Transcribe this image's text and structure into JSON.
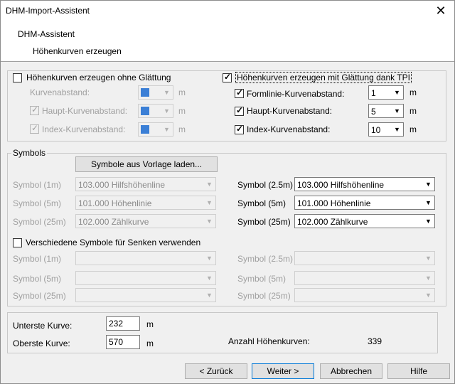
{
  "window": {
    "title": "DHM-Import-Assistent",
    "close_glyph": "✕"
  },
  "header": {
    "title": "DHM-Assistent",
    "subtitle": "Höhenkurven erzeugen"
  },
  "smoothing": {
    "without": {
      "label": "Höhenkurven erzeugen ohne Glättung",
      "checked": false
    },
    "with": {
      "label": "Höhenkurven erzeugen mit Glättung dank TPI",
      "checked": true
    }
  },
  "left_params": {
    "kurvenabstand": {
      "label": "Kurvenabstand:",
      "unit": "m"
    },
    "haupt": {
      "label": "Haupt-Kurvenabstand:",
      "unit": "m",
      "checked": true
    },
    "index": {
      "label": "Index-Kurvenabstand:",
      "unit": "m",
      "checked": true
    }
  },
  "right_params": {
    "formlinie": {
      "label": "Formlinie-Kurvenabstand:",
      "value": "1",
      "unit": "m",
      "checked": true
    },
    "haupt": {
      "label": "Haupt-Kurvenabstand:",
      "value": "5",
      "unit": "m",
      "checked": true
    },
    "index": {
      "label": "Index-Kurvenabstand:",
      "value": "10",
      "unit": "m",
      "checked": true
    }
  },
  "symbols": {
    "group_title": "Symbols",
    "load_button": "Symbole aus Vorlage laden...",
    "left": [
      {
        "label": "Symbol (1m)",
        "value": "103.000 Hilfshöhenline"
      },
      {
        "label": "Symbol (5m)",
        "value": "101.000 Höhenlinie"
      },
      {
        "label": "Symbol (25m)",
        "value": "102.000 Zählkurve"
      }
    ],
    "right": [
      {
        "label": "Symbol (2.5m)",
        "value": "103.000 Hilfshöhenline"
      },
      {
        "label": "Symbol (5m)",
        "value": "101.000 Höhenlinie"
      },
      {
        "label": "Symbol (25m)",
        "value": "102.000 Zählkurve"
      }
    ],
    "senken": {
      "label": "Verschiedene Symbole für Senken verwenden",
      "checked": false
    },
    "senken_left": [
      {
        "label": "Symbol (1m)",
        "value": ""
      },
      {
        "label": "Symbol (5m)",
        "value": ""
      },
      {
        "label": "Symbol (25m)",
        "value": ""
      }
    ],
    "senken_right": [
      {
        "label": "Symbol (2.5m)",
        "value": ""
      },
      {
        "label": "Symbol (5m)",
        "value": ""
      },
      {
        "label": "Symbol (25m)",
        "value": ""
      }
    ]
  },
  "range": {
    "lowest": {
      "label": "Unterste Kurve:",
      "value": "232",
      "unit": "m"
    },
    "highest": {
      "label": "Oberste Kurve:",
      "value": "570",
      "unit": "m"
    },
    "count": {
      "label": "Anzahl Höhenkurven:",
      "value": "339"
    }
  },
  "buttons": {
    "back": "< Zurück",
    "next": "Weiter >",
    "cancel": "Abbrechen",
    "help": "Hilfe"
  }
}
